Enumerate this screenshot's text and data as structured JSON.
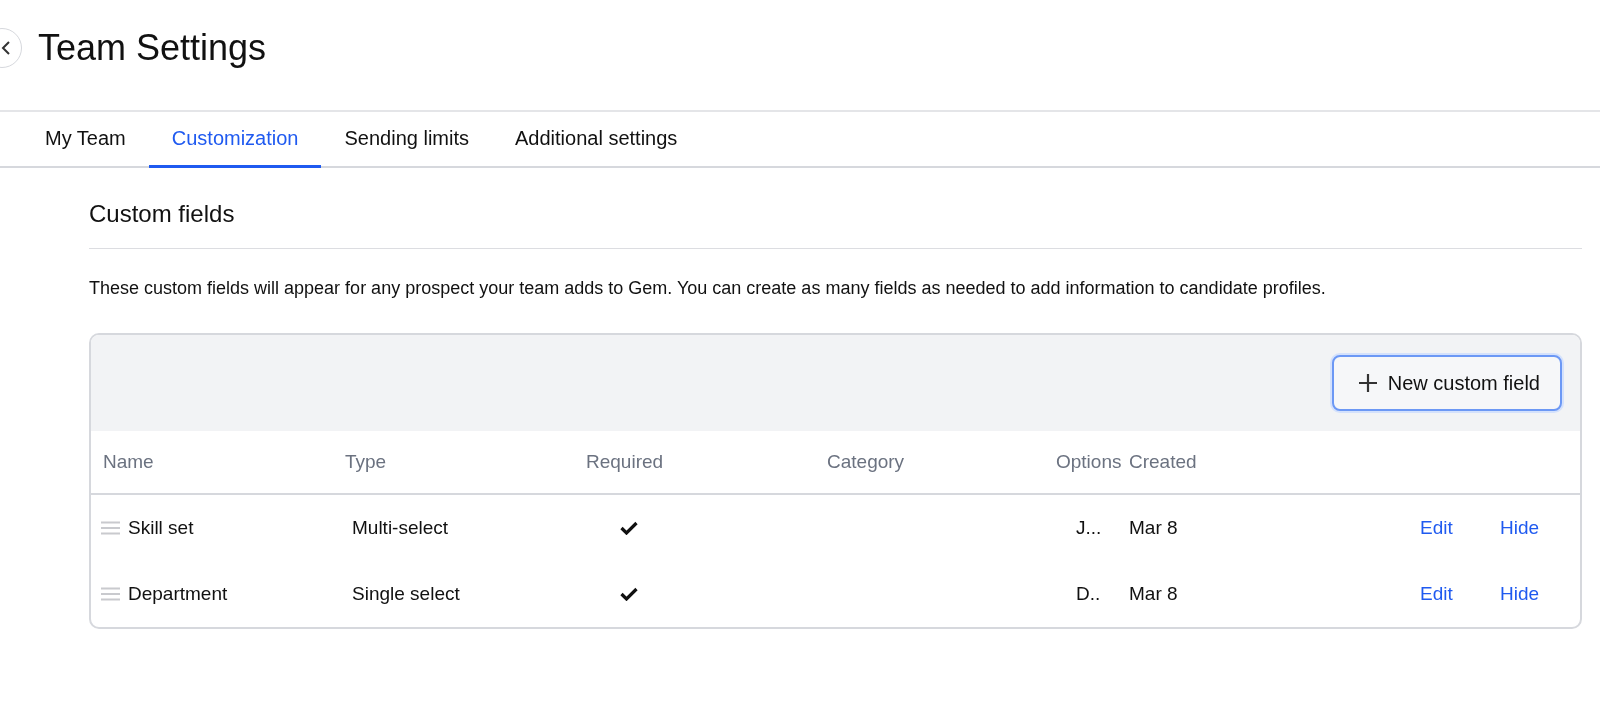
{
  "page": {
    "title": "Team Settings"
  },
  "tabs": [
    {
      "label": "My Team",
      "selected": false
    },
    {
      "label": "Customization",
      "selected": true
    },
    {
      "label": "Sending limits",
      "selected": false
    },
    {
      "label": "Additional settings",
      "selected": false
    }
  ],
  "section": {
    "heading": "Custom fields",
    "description": "These custom fields will appear for any prospect your team adds to Gem. You can create as many fields as needed to add information to candidate profiles."
  },
  "table": {
    "new_button": "New custom field",
    "columns": [
      "Name",
      "Type",
      "Required",
      "Category",
      "Options",
      "Created"
    ],
    "rows": [
      {
        "name": "Skill set",
        "type": "Multi-select",
        "required": true,
        "options": "J...",
        "created": "Mar 8",
        "actions": [
          "Edit",
          "Hide"
        ]
      },
      {
        "name": "Department",
        "type": "Single select",
        "required": true,
        "options": "D..",
        "created": "Mar 8",
        "actions": [
          "Edit",
          "Hide"
        ]
      }
    ]
  }
}
